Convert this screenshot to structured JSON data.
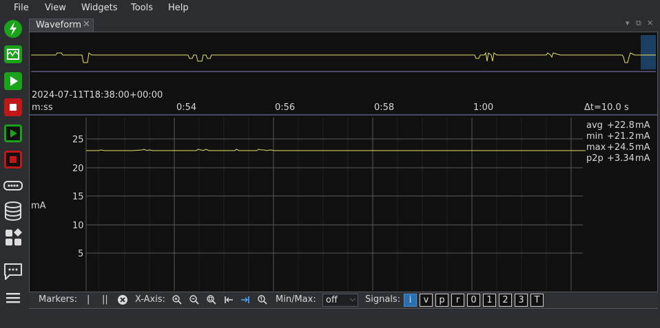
{
  "menu": [
    "File",
    "View",
    "Widgets",
    "Tools",
    "Help"
  ],
  "sidebar": {
    "icons": [
      "power-icon",
      "capture-icon",
      "play-icon",
      "stop-icon",
      "play-single-icon",
      "stop-single-icon",
      "device-icon",
      "storage-icon",
      "widgets-icon",
      "chat-icon",
      "menu-icon"
    ]
  },
  "tab": {
    "label": "Waveform",
    "close": "✕"
  },
  "timeline": {
    "timestamp": "2024-07-11T18:38:00+00:00",
    "format": "m:ss",
    "ticks": [
      "0:54",
      "0:56",
      "0:58",
      "1:00"
    ],
    "delta": "Δt=10.0 s"
  },
  "plot": {
    "ylabel": "mA",
    "yticks": [
      "25",
      "20",
      "15",
      "10",
      "5"
    ],
    "stats": [
      {
        "label": "avg",
        "value": "+22.8",
        "unit": "mA"
      },
      {
        "label": "min",
        "value": "+21.2",
        "unit": "mA"
      },
      {
        "label": "max",
        "value": "+24.5",
        "unit": "mA"
      },
      {
        "label": "p2p",
        "value": "+3.34",
        "unit": "mA"
      }
    ]
  },
  "toolbar": {
    "markers_label": "Markers:",
    "marker_single": "|",
    "marker_dual": "||",
    "xaxis_label": "X-Axis:",
    "minmax_label": "Min/Max:",
    "minmax_value": "off",
    "signals_label": "Signals:",
    "signals": [
      "i",
      "v",
      "p",
      "r",
      "0",
      "1",
      "2",
      "3",
      "T"
    ],
    "active_signal": "i"
  },
  "colors": {
    "trace": "#e8e26a",
    "accent": "#4a90d9",
    "green": "#1aa31a",
    "red": "#c01818"
  }
}
